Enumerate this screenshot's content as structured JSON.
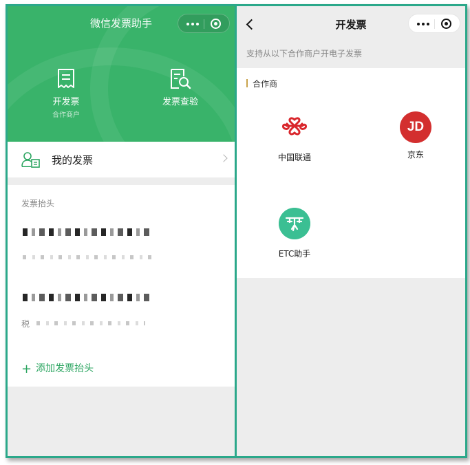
{
  "left": {
    "title": "微信发票助手",
    "actions": [
      {
        "label": "开发票",
        "sublabel": "合作商户",
        "icon": "invoice-receipt-icon"
      },
      {
        "label": "发票查验",
        "icon": "invoice-search-icon"
      }
    ],
    "my_invoices_label": "我的发票",
    "invoice_header_section": "发票抬头",
    "tax_prefix": "税",
    "add_header_label": "添加发票抬头"
  },
  "right": {
    "title": "开发票",
    "hint": "支持从以下合作商户开电子发票",
    "partners_label": "合作商",
    "partners": [
      {
        "name": "中国联通",
        "icon": "china-unicom-logo"
      },
      {
        "name": "京东",
        "icon": "jd-logo",
        "logo_text": "JD"
      },
      {
        "name": "ETC助手",
        "icon": "etc-logo"
      }
    ]
  },
  "colors": {
    "brand_green": "#39b36a",
    "frame": "#2ba88a",
    "link_green": "#2ba560",
    "jd_red": "#d32f2f",
    "unicom_red": "#d9262c"
  }
}
